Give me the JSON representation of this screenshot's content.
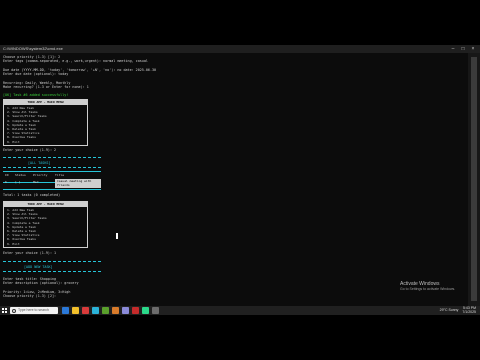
{
  "window": {
    "title": "C:\\WINDOWS\\system32\\cmd.exe"
  },
  "terminal": {
    "header_lines": [
      "Choose priority (1-3) [1]: 2",
      "Enter tags (comma-separated, e.g., work,urgent): normal meeting, casual",
      "",
      "Due date (YYYY-MM-DD, 'today', 'tomorrow', '+N', 'no'): no date: 2025-06-30",
      "Enter due date (optional): today",
      "",
      "Recurring: Daily, Weekly, Monthly",
      "Make recurring? (1-3 or Enter for none): 1",
      ""
    ],
    "added_msg": "[OK] Task #6 added successfully!",
    "menu1": {
      "title": "TODO APP - MAIN MENU",
      "items": [
        "1. Add New Task",
        "2. Show All Tasks",
        "3. Search/Filter Tasks",
        "4. Complete a Task",
        "5. Update a Task",
        "6. Delete a Task",
        "7. View Statistics",
        "8. Overdue Tasks",
        "9. Exit"
      ]
    },
    "choice1": "Enter your choice (1-9): 2",
    "all_tasks_label": "[ALL TASKS]",
    "table": {
      "headers": [
        "ID",
        "Status",
        "Priority",
        "Title"
      ],
      "row": [
        "6",
        "[ ]",
        "Med",
        "Casual meeting with friends"
      ],
      "tag": "Casual meeting with friends"
    },
    "total": "Total: 1 tasks (0 completed)",
    "menu2": {
      "title": "TODO APP - MAIN MENU",
      "items": [
        "1. Add New Task",
        "2. Show All Tasks",
        "3. Search/Filter Tasks",
        "4. Complete a Task",
        "5. Update a Task",
        "6. Delete a Task",
        "7. View Statistics",
        "8. Overdue Tasks",
        "9. Exit"
      ]
    },
    "choice2": "Enter your choice (1-9): 1",
    "add_new_task_label": "[ADD NEW TASK]",
    "footer_lines": [
      "Enter task title: Shopping",
      "Enter description (optional): grocery",
      "",
      "Priority: 1=Low, 2=Medium, 3=High",
      "Choose priority (1-3) [2]:"
    ]
  },
  "watermark": {
    "line1": "Activate Windows",
    "line2": "Go to Settings to activate Windows."
  },
  "taskbar": {
    "search_placeholder": "Type here to search",
    "app_colors": [
      "#2b79d8",
      "#f2c02b",
      "#d83b3b",
      "#2bb3d8",
      "#5aa02c",
      "#d87b2b",
      "#8a8ad8",
      "#c42b2b",
      "#2bd88a",
      "#6c6c6c"
    ],
    "weather": "29°C Sunny",
    "time": "5:43 PM",
    "date": "7/1/2025"
  }
}
